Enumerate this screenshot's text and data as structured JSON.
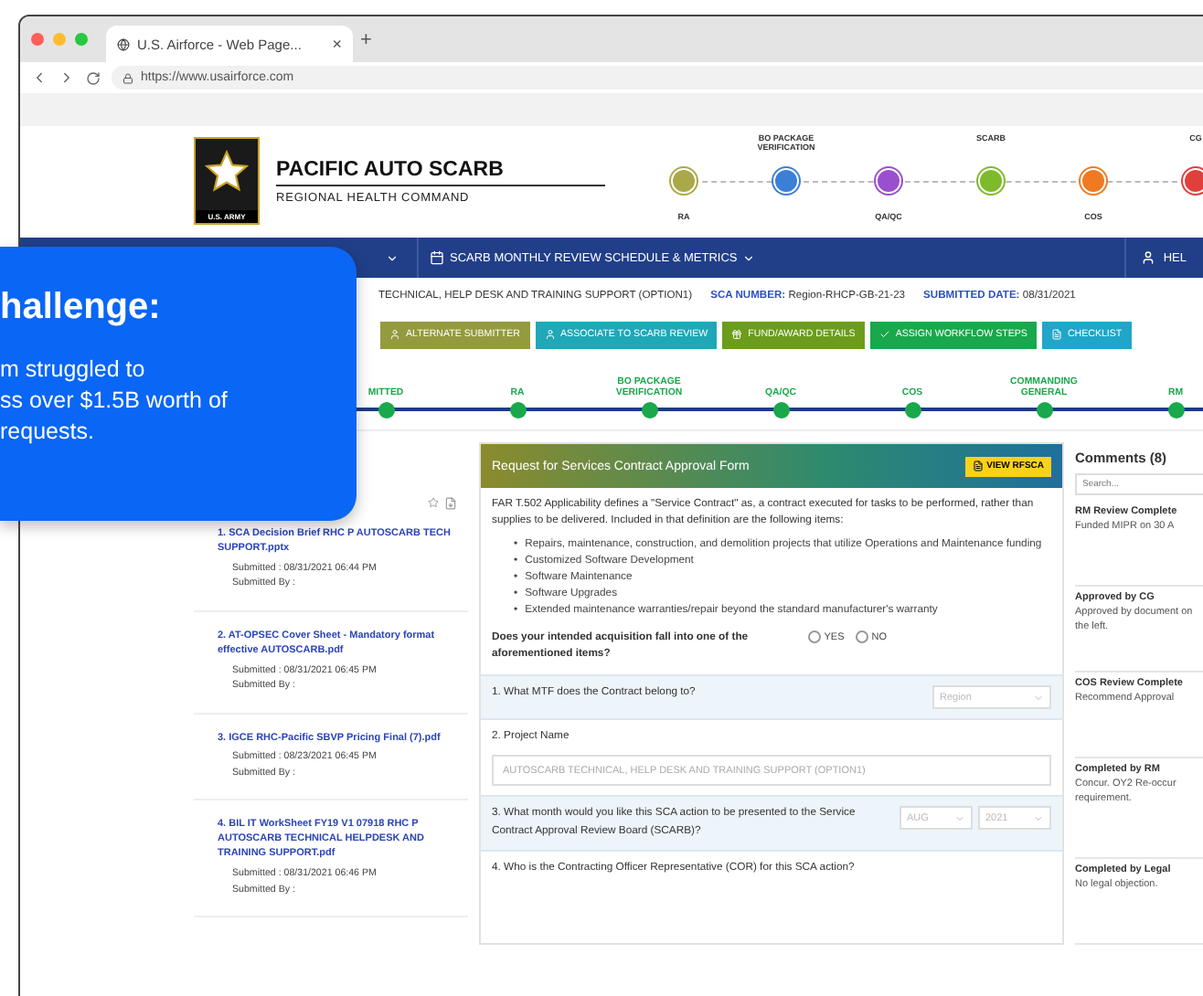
{
  "browser": {
    "tab_title": "U.S. Airforce - Web Page...",
    "tab_close": "×",
    "new_tab": "+",
    "url": "https://www.usairforce.com"
  },
  "header": {
    "badge": "U.S. ARMY",
    "title": "PACIFIC AUTO SCARB",
    "subtitle": "REGIONAL HEALTH COMMAND",
    "stages": [
      {
        "label": "RA",
        "kind": "below",
        "color": "#a9a94a"
      },
      {
        "label": "BO PACKAGE VERIFICATION",
        "kind": "above",
        "color": "#3b7fd6"
      },
      {
        "label": "QA/QC",
        "kind": "below",
        "color": "#9a4fcf"
      },
      {
        "label": "SCARB",
        "kind": "above",
        "color": "#7dbb2a"
      },
      {
        "label": "COS",
        "kind": "below",
        "color": "#f07a22"
      },
      {
        "label": "CG",
        "kind": "above",
        "color": "#e0403c"
      }
    ]
  },
  "nav": {
    "items": [
      {
        "label": "SCARB MONTHLY REVIEW SCHEDULE & METRICS"
      }
    ],
    "help": "HEL"
  },
  "info": {
    "title": "TECHNICAL, HELP DESK AND TRAINING SUPPORT (OPTION1)",
    "sca_label": "SCA NUMBER:",
    "sca_value": "Region-RHCP-GB-21-23",
    "date_label": "SUBMITTED DATE:",
    "date_value": "08/31/2021"
  },
  "actions": [
    {
      "label": "ALTERNATE SUBMITTER",
      "color": "#949a3e"
    },
    {
      "label": "ASSOCIATE TO SCARB REVIEW",
      "color": "#20a7b8"
    },
    {
      "label": "FUND/AWARD DETAILS",
      "color": "#6c9c1c"
    },
    {
      "label": "ASSIGN WORKFLOW STEPS",
      "color": "#19a84c"
    },
    {
      "label": "CHECKLIST",
      "color": "#1fa6c9"
    }
  ],
  "progress": [
    {
      "label": "MITTED"
    },
    {
      "label": "RA"
    },
    {
      "label": "BO PACKAGE VERIFICATION"
    },
    {
      "label": "QA/QC"
    },
    {
      "label": "COS"
    },
    {
      "label": "COMMANDING GENERAL"
    },
    {
      "label": "RM"
    }
  ],
  "documents": [
    {
      "title": "1. SCA Decision Brief RHC P AUTOSCARB TECH SUPPORT.pptx",
      "submitted": "Submitted : 08/31/2021 06:44 PM",
      "submitted_by": "Submitted By :"
    },
    {
      "title": "2. AT-OPSEC Cover Sheet - Mandatory format effective AUTOSCARB.pdf",
      "submitted": "Submitted : 08/31/2021 06:45 PM",
      "submitted_by": "Submitted By :"
    },
    {
      "title": "3. IGCE RHC-Pacific SBVP Pricing Final (7).pdf",
      "submitted": "Submitted : 08/23/2021 06:45 PM",
      "submitted_by": "Submitted By :"
    },
    {
      "title": "4. BIL IT WorkSheet FY19 V1 07918 RHC P AUTOSCARB TECHNICAL HELPDESK AND TRAINING SUPPORT.pdf",
      "submitted": "Submitted : 08/31/2021 06:46 PM",
      "submitted_by": "Submitted By :"
    }
  ],
  "form": {
    "title": "Request for Services Contract Approval Form",
    "view_button": "VIEW RFSCA",
    "intro": "FAR T.502 Applicability defines a \"Service Contract\" as, a contract executed for tasks to be performed, rather than supplies to be delivered. Included in that definition are the following items:",
    "bullet_marker": "•",
    "bullets": [
      "Repairs, maintenance, construction, and demolition projects that utilize Operations and Maintenance funding",
      "Customized Software Development",
      "Software Maintenance",
      "Software Upgrades",
      "Extended maintenance warranties/repair beyond the standard manufacturer's warranty"
    ],
    "question": "Does your intended acquisition fall into one of the aforementioned items?",
    "options": [
      {
        "label": "YES",
        "selected": false
      },
      {
        "label": "NO",
        "selected": false
      }
    ],
    "questions": [
      {
        "kind": "select",
        "label": "1. What MTF does the Contract belong to?",
        "selects": [
          "Region"
        ]
      },
      {
        "kind": "text",
        "label": "2. Project Name",
        "value": "AUTOSCARB TECHNICAL, HELP DESK AND TRAINING SUPPORT (OPTION1)"
      },
      {
        "kind": "select",
        "label": "3. What month would you like this SCA action to be presented to the Service Contract Approval Review Board (SCARB)?",
        "selects": [
          "AUG",
          "2021"
        ]
      },
      {
        "kind": "plain",
        "label": "4. Who is the Contracting Officer Representative (COR) for this SCA action?"
      }
    ]
  },
  "comments": {
    "title": "Comments (8)",
    "search_placeholder": "Search...",
    "items": [
      {
        "title": "RM Review Complete",
        "text": "Funded MIPR on 30 A"
      },
      {
        "title": "Approved by CG",
        "text": "Approved by document on the left."
      },
      {
        "title": "COS Review Complete",
        "text": "Recommend Approval"
      },
      {
        "title": "Completed by RM",
        "text": "Concur. OY2 Re-occur requirement."
      },
      {
        "title": "Completed by Legal",
        "text": "No legal objection."
      }
    ]
  },
  "callout": {
    "title": "hallenge:",
    "lines": [
      "m struggled to",
      "ss over $1.5B worth of",
      "requests."
    ]
  }
}
